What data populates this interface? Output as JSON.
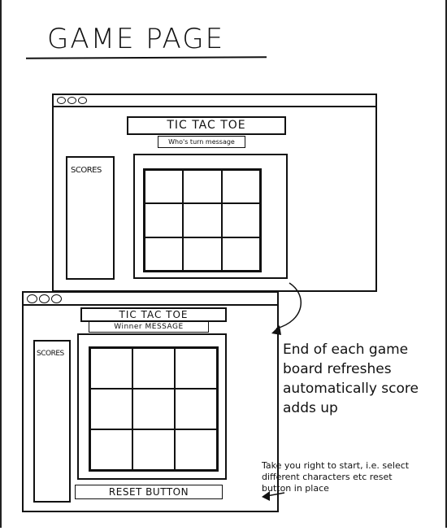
{
  "page": {
    "title": "GAME PAGE"
  },
  "screen1": {
    "heading": "TIC TAC TOE",
    "message": "Who's turn message",
    "scores_label": "SCORES",
    "board": {
      "rows": 3,
      "cols": 3
    }
  },
  "screen2": {
    "heading": "TIC TAC TOE",
    "message": "Winner MESSAGE",
    "scores_label": "SCORES",
    "board": {
      "rows": 3,
      "cols": 3
    },
    "reset_label": "RESET BUTTON"
  },
  "notes": {
    "end_of_game": "End of each game board refreshes automatically score adds up",
    "take_you_right": "Take you right to start, i.e. select different characters etc reset button in place"
  }
}
